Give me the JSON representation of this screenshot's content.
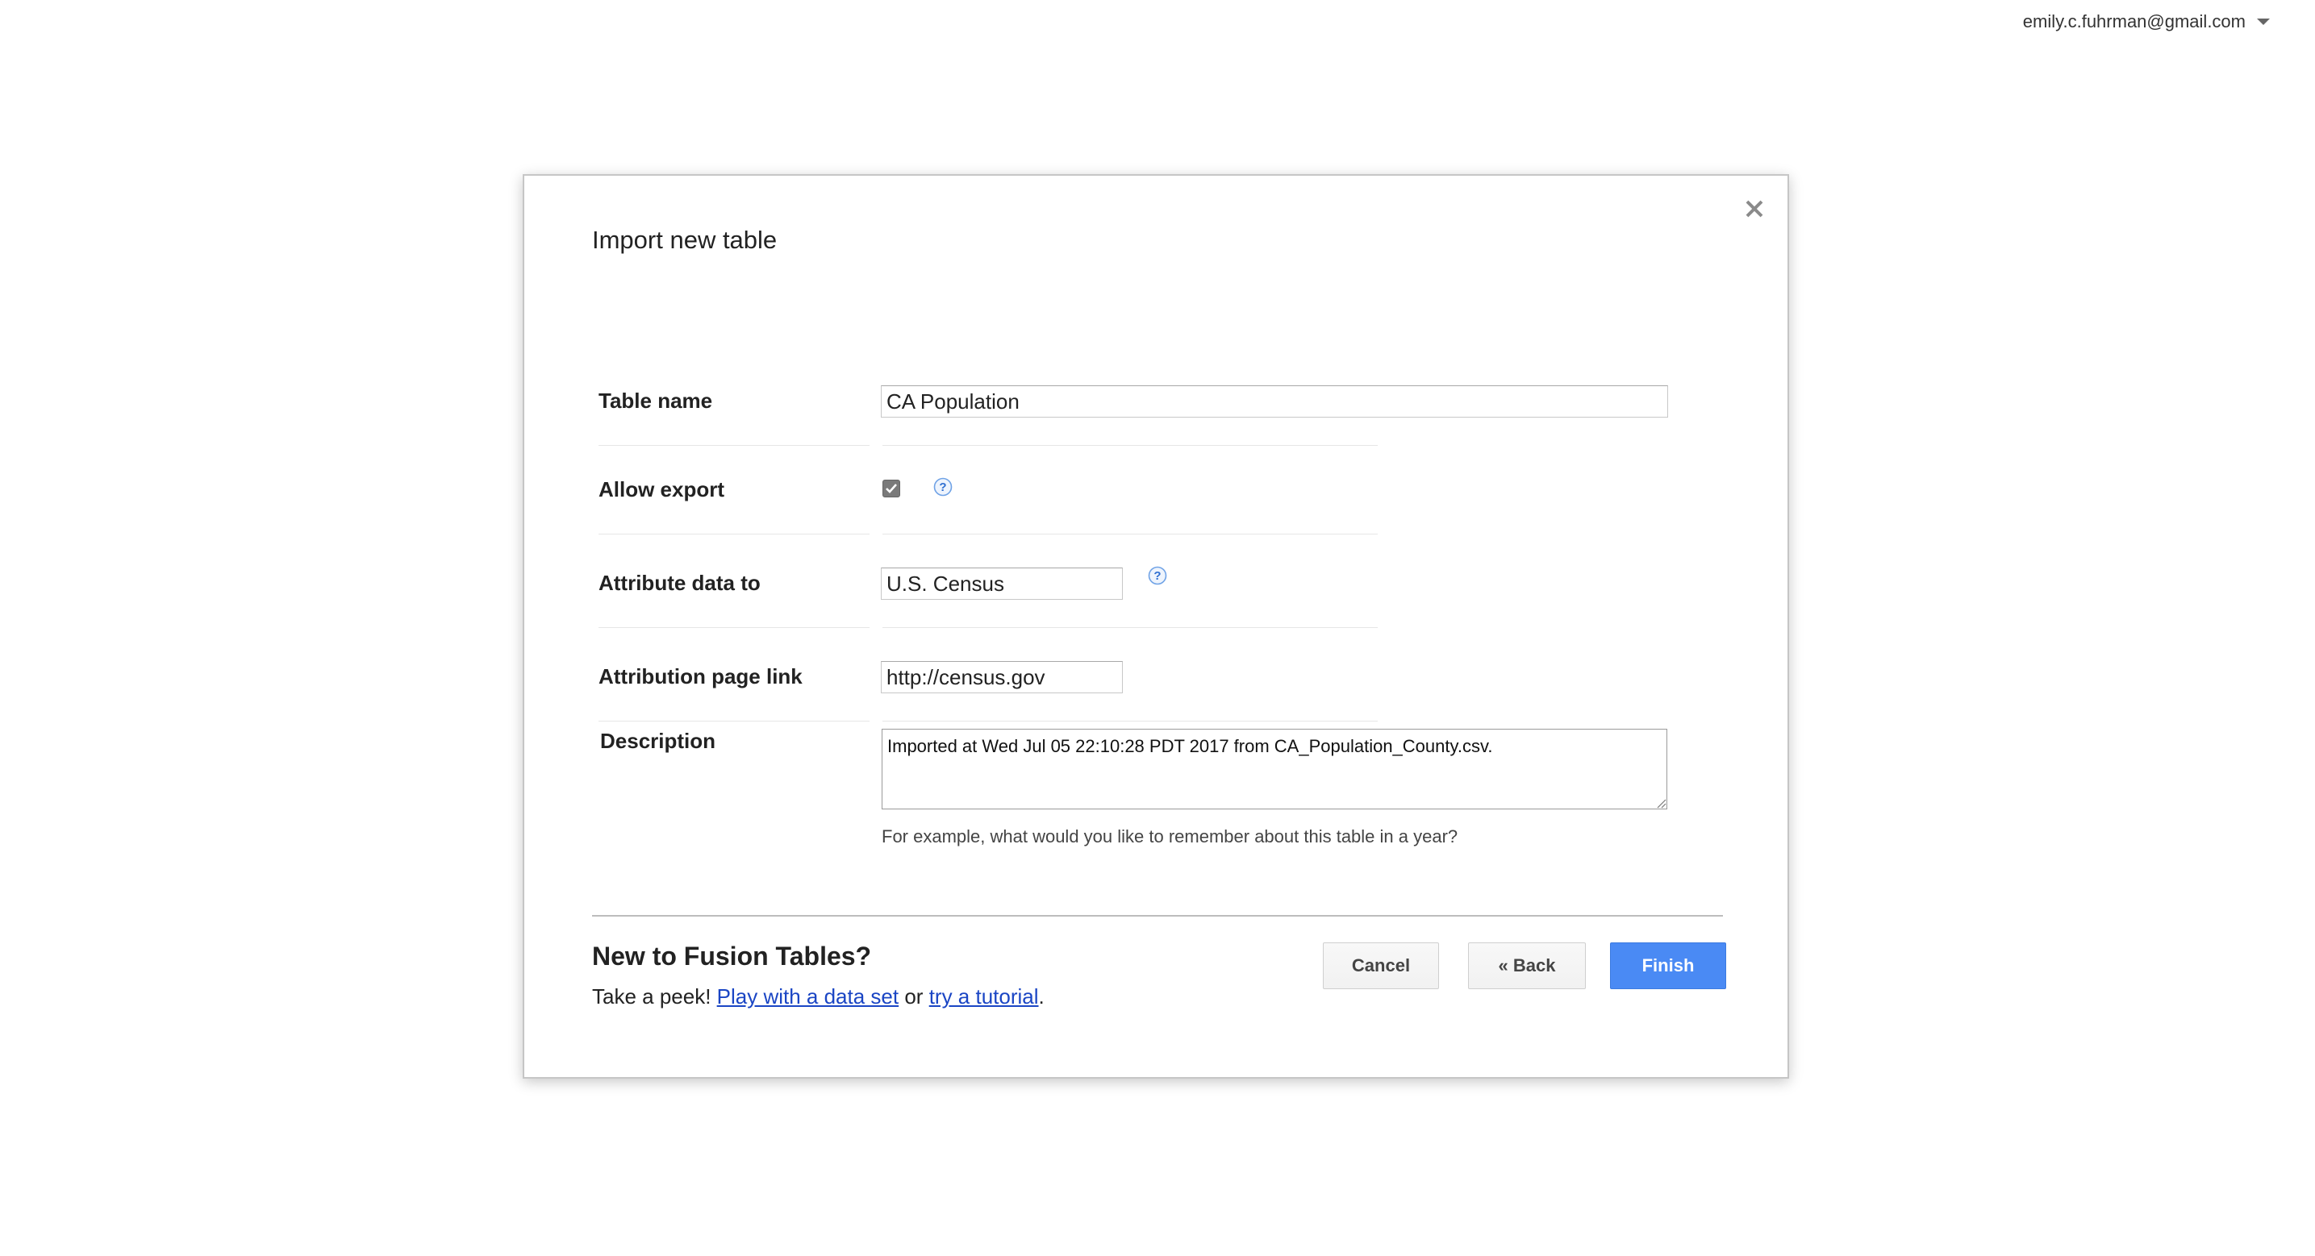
{
  "header": {
    "account_email": "emily.c.fuhrman@gmail.com"
  },
  "dialog": {
    "title": "Import new table",
    "fields": {
      "table_name": {
        "label": "Table name",
        "value": "CA Population"
      },
      "allow_export": {
        "label": "Allow export",
        "checked": true
      },
      "attribute_data_to": {
        "label": "Attribute data to",
        "value": "U.S. Census"
      },
      "attribution_page_link": {
        "label": "Attribution page link",
        "value": "http://census.gov"
      },
      "description": {
        "label": "Description",
        "value": "Imported at Wed Jul 05 22:10:28 PDT 2017 from CA_Population_County.csv.",
        "hint": "For example, what would you like to remember about this table in a year?"
      }
    },
    "footer": {
      "heading": "New to Fusion Tables?",
      "intro": "Take a peek! ",
      "link1": "Play with a data set",
      "connector": " or ",
      "link2": "try a tutorial",
      "end": "."
    },
    "buttons": {
      "cancel": "Cancel",
      "back": "« Back",
      "finish": "Finish"
    }
  },
  "colors": {
    "primary_button": "#4a8af4",
    "link": "#1a45c4",
    "help_icon": "#6fa2e6"
  }
}
